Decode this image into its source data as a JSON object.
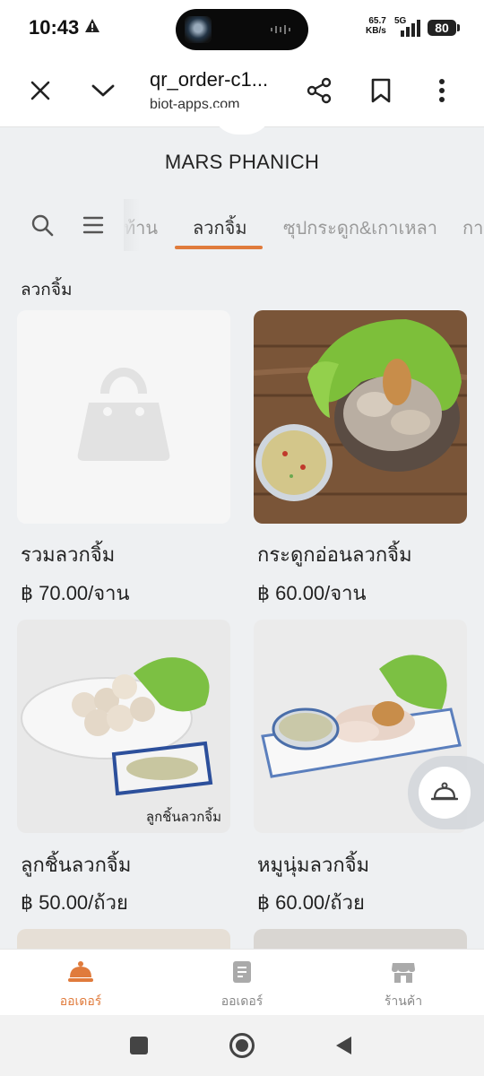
{
  "status": {
    "time": "10:43",
    "net_speed_value": "65.7",
    "net_speed_unit": "KB/s",
    "network": "5G",
    "battery": "80"
  },
  "browser": {
    "title": "qr_order-c1...",
    "domain": "biot-apps.com"
  },
  "store": {
    "name": "MARS PHANICH"
  },
  "tabs": [
    {
      "label": "ท้าน"
    },
    {
      "label": "ลวกจิ้ม",
      "active": true
    },
    {
      "label": "ซุปกระดูก&เกาเหลา"
    },
    {
      "label": "กาะ"
    }
  ],
  "section": {
    "title": "ลวกจิ้ม"
  },
  "items": [
    {
      "name": "รวมลวกจิ้ม",
      "price": "฿ 70.00/จาน",
      "image": "placeholder-bag-icon"
    },
    {
      "name": "กระดูกอ่อนลวกจิ้ม",
      "price": "฿ 60.00/จาน",
      "image": "boiled-cartilage-with-lettuce"
    },
    {
      "name": "ลูกชิ้นลวกจิ้ม",
      "price": "฿ 50.00/ถ้วย",
      "image": "meatballs-with-dipping-sauce",
      "caption": "ลูกชิ้นลวกจิ้ม"
    },
    {
      "name": "หมูนุ่มลวกจิ้ม",
      "price": "฿ 60.00/ถ้วย",
      "image": "sliced-pork-with-dipping-sauce"
    }
  ],
  "floating": {
    "icon": "service-bell-icon"
  },
  "bottom_nav": [
    {
      "label": "ออเดอร์",
      "icon": "cloche-icon",
      "active": true
    },
    {
      "label": "ออเดอร์",
      "icon": "receipt-icon"
    },
    {
      "label": "ร้านค้า",
      "icon": "store-icon"
    }
  ],
  "colors": {
    "accent": "#e07b3c",
    "background": "#eef0f2"
  }
}
